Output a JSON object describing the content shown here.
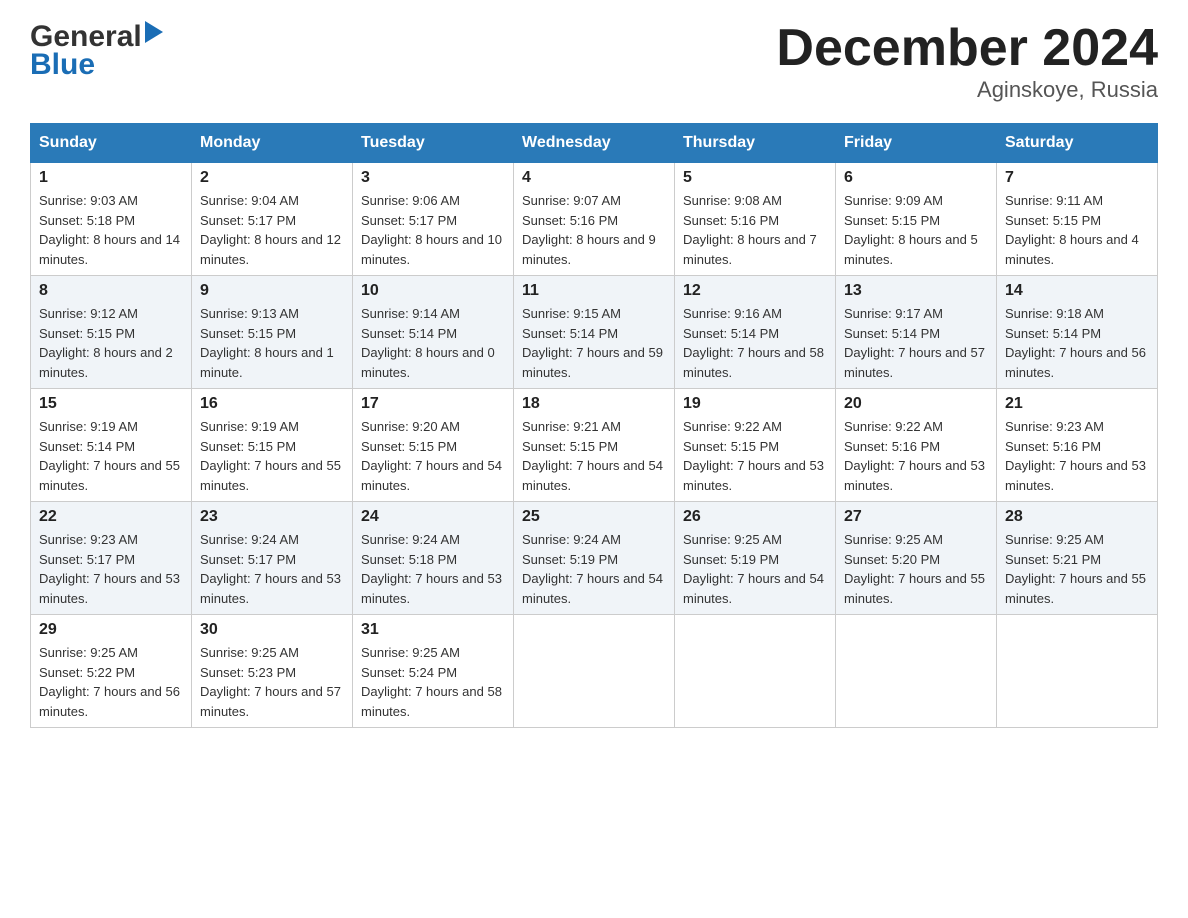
{
  "header": {
    "title": "December 2024",
    "subtitle": "Aginskoye, Russia",
    "logo_general": "General",
    "logo_blue": "Blue"
  },
  "days_of_week": [
    "Sunday",
    "Monday",
    "Tuesday",
    "Wednesday",
    "Thursday",
    "Friday",
    "Saturday"
  ],
  "weeks": [
    [
      {
        "day": "1",
        "sunrise": "Sunrise: 9:03 AM",
        "sunset": "Sunset: 5:18 PM",
        "daylight": "Daylight: 8 hours and 14 minutes."
      },
      {
        "day": "2",
        "sunrise": "Sunrise: 9:04 AM",
        "sunset": "Sunset: 5:17 PM",
        "daylight": "Daylight: 8 hours and 12 minutes."
      },
      {
        "day": "3",
        "sunrise": "Sunrise: 9:06 AM",
        "sunset": "Sunset: 5:17 PM",
        "daylight": "Daylight: 8 hours and 10 minutes."
      },
      {
        "day": "4",
        "sunrise": "Sunrise: 9:07 AM",
        "sunset": "Sunset: 5:16 PM",
        "daylight": "Daylight: 8 hours and 9 minutes."
      },
      {
        "day": "5",
        "sunrise": "Sunrise: 9:08 AM",
        "sunset": "Sunset: 5:16 PM",
        "daylight": "Daylight: 8 hours and 7 minutes."
      },
      {
        "day": "6",
        "sunrise": "Sunrise: 9:09 AM",
        "sunset": "Sunset: 5:15 PM",
        "daylight": "Daylight: 8 hours and 5 minutes."
      },
      {
        "day": "7",
        "sunrise": "Sunrise: 9:11 AM",
        "sunset": "Sunset: 5:15 PM",
        "daylight": "Daylight: 8 hours and 4 minutes."
      }
    ],
    [
      {
        "day": "8",
        "sunrise": "Sunrise: 9:12 AM",
        "sunset": "Sunset: 5:15 PM",
        "daylight": "Daylight: 8 hours and 2 minutes."
      },
      {
        "day": "9",
        "sunrise": "Sunrise: 9:13 AM",
        "sunset": "Sunset: 5:15 PM",
        "daylight": "Daylight: 8 hours and 1 minute."
      },
      {
        "day": "10",
        "sunrise": "Sunrise: 9:14 AM",
        "sunset": "Sunset: 5:14 PM",
        "daylight": "Daylight: 8 hours and 0 minutes."
      },
      {
        "day": "11",
        "sunrise": "Sunrise: 9:15 AM",
        "sunset": "Sunset: 5:14 PM",
        "daylight": "Daylight: 7 hours and 59 minutes."
      },
      {
        "day": "12",
        "sunrise": "Sunrise: 9:16 AM",
        "sunset": "Sunset: 5:14 PM",
        "daylight": "Daylight: 7 hours and 58 minutes."
      },
      {
        "day": "13",
        "sunrise": "Sunrise: 9:17 AM",
        "sunset": "Sunset: 5:14 PM",
        "daylight": "Daylight: 7 hours and 57 minutes."
      },
      {
        "day": "14",
        "sunrise": "Sunrise: 9:18 AM",
        "sunset": "Sunset: 5:14 PM",
        "daylight": "Daylight: 7 hours and 56 minutes."
      }
    ],
    [
      {
        "day": "15",
        "sunrise": "Sunrise: 9:19 AM",
        "sunset": "Sunset: 5:14 PM",
        "daylight": "Daylight: 7 hours and 55 minutes."
      },
      {
        "day": "16",
        "sunrise": "Sunrise: 9:19 AM",
        "sunset": "Sunset: 5:15 PM",
        "daylight": "Daylight: 7 hours and 55 minutes."
      },
      {
        "day": "17",
        "sunrise": "Sunrise: 9:20 AM",
        "sunset": "Sunset: 5:15 PM",
        "daylight": "Daylight: 7 hours and 54 minutes."
      },
      {
        "day": "18",
        "sunrise": "Sunrise: 9:21 AM",
        "sunset": "Sunset: 5:15 PM",
        "daylight": "Daylight: 7 hours and 54 minutes."
      },
      {
        "day": "19",
        "sunrise": "Sunrise: 9:22 AM",
        "sunset": "Sunset: 5:15 PM",
        "daylight": "Daylight: 7 hours and 53 minutes."
      },
      {
        "day": "20",
        "sunrise": "Sunrise: 9:22 AM",
        "sunset": "Sunset: 5:16 PM",
        "daylight": "Daylight: 7 hours and 53 minutes."
      },
      {
        "day": "21",
        "sunrise": "Sunrise: 9:23 AM",
        "sunset": "Sunset: 5:16 PM",
        "daylight": "Daylight: 7 hours and 53 minutes."
      }
    ],
    [
      {
        "day": "22",
        "sunrise": "Sunrise: 9:23 AM",
        "sunset": "Sunset: 5:17 PM",
        "daylight": "Daylight: 7 hours and 53 minutes."
      },
      {
        "day": "23",
        "sunrise": "Sunrise: 9:24 AM",
        "sunset": "Sunset: 5:17 PM",
        "daylight": "Daylight: 7 hours and 53 minutes."
      },
      {
        "day": "24",
        "sunrise": "Sunrise: 9:24 AM",
        "sunset": "Sunset: 5:18 PM",
        "daylight": "Daylight: 7 hours and 53 minutes."
      },
      {
        "day": "25",
        "sunrise": "Sunrise: 9:24 AM",
        "sunset": "Sunset: 5:19 PM",
        "daylight": "Daylight: 7 hours and 54 minutes."
      },
      {
        "day": "26",
        "sunrise": "Sunrise: 9:25 AM",
        "sunset": "Sunset: 5:19 PM",
        "daylight": "Daylight: 7 hours and 54 minutes."
      },
      {
        "day": "27",
        "sunrise": "Sunrise: 9:25 AM",
        "sunset": "Sunset: 5:20 PM",
        "daylight": "Daylight: 7 hours and 55 minutes."
      },
      {
        "day": "28",
        "sunrise": "Sunrise: 9:25 AM",
        "sunset": "Sunset: 5:21 PM",
        "daylight": "Daylight: 7 hours and 55 minutes."
      }
    ],
    [
      {
        "day": "29",
        "sunrise": "Sunrise: 9:25 AM",
        "sunset": "Sunset: 5:22 PM",
        "daylight": "Daylight: 7 hours and 56 minutes."
      },
      {
        "day": "30",
        "sunrise": "Sunrise: 9:25 AM",
        "sunset": "Sunset: 5:23 PM",
        "daylight": "Daylight: 7 hours and 57 minutes."
      },
      {
        "day": "31",
        "sunrise": "Sunrise: 9:25 AM",
        "sunset": "Sunset: 5:24 PM",
        "daylight": "Daylight: 7 hours and 58 minutes."
      },
      {
        "day": "",
        "sunrise": "",
        "sunset": "",
        "daylight": ""
      },
      {
        "day": "",
        "sunrise": "",
        "sunset": "",
        "daylight": ""
      },
      {
        "day": "",
        "sunrise": "",
        "sunset": "",
        "daylight": ""
      },
      {
        "day": "",
        "sunrise": "",
        "sunset": "",
        "daylight": ""
      }
    ]
  ]
}
